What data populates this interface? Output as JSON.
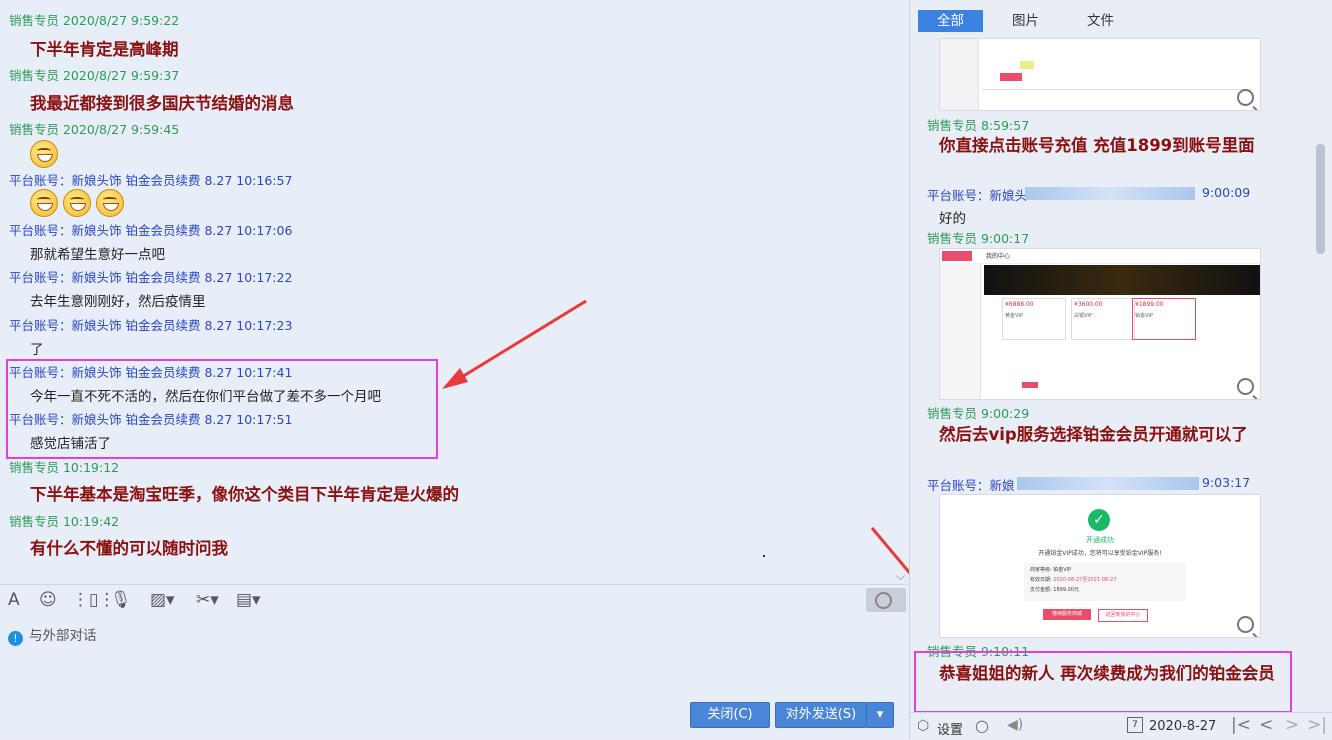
{
  "chat": {
    "messages": [
      {
        "sender": "销售专员 2020/8/27 9:59:22",
        "text": "下半年肯定是高峰期"
      },
      {
        "sender": "销售专员 2020/8/27 9:59:37",
        "text": "我最近都接到很多国庆节结婚的消息"
      },
      {
        "sender": "销售专员 2020/8/27 9:59:45",
        "emoji": "grin-emoji"
      },
      {
        "sender": "平台账号：新娘头饰 铂金会员续费 8.27   10:16:57",
        "emoji": "grin-emoji x3"
      },
      {
        "sender": "平台账号：新娘头饰 铂金会员续费 8.27   10:17:06",
        "text": "那就希望生意好一点吧"
      },
      {
        "sender": "平台账号：新娘头饰 铂金会员续费 8.27   10:17:22",
        "text": "去年生意刚刚好，然后疫情里"
      },
      {
        "sender": "平台账号：新娘头饰 铂金会员续费 8.27   10:17:23",
        "text": "了"
      },
      {
        "sender": "平台账号：新娘头饰 铂金会员续费 8.27   10:17:41",
        "text": "今年一直不死不活的，然后在你们平台做了差不多一个月吧"
      },
      {
        "sender": "平台账号：新娘头饰 铂金会员续费 8.27   10:17:51",
        "text": "感觉店铺活了"
      },
      {
        "sender": "销售专员  10:19:12",
        "text": "下半年基本是淘宝旺季，像你这个类目下半年肯定是火爆的"
      },
      {
        "sender": "销售专员  10:19:42",
        "text": "有什么不懂的可以随时问我"
      }
    ]
  },
  "composer": {
    "tip": "与外部对话",
    "close_label": "关闭(C)",
    "send_label": "对外发送(S)"
  },
  "history": {
    "tabs": [
      "全部",
      "图片",
      "文件"
    ],
    "items": [
      {
        "sender": "销售专员 8:59:57",
        "text": "你直接点击账号充值 充值1899到账号里面"
      },
      {
        "sender_a": "平台账号：新娘头",
        "sender_b": "9:00:09",
        "text": "好的"
      },
      {
        "sender": "销售专员 9:00:17"
      },
      {
        "sender": "销售专员 9:00:29",
        "text": "然后去vip服务选择铂金会员开通就可以了"
      },
      {
        "sender_a": "平台账号：新娘",
        "sender_b": "9:03:17"
      },
      {
        "sender": "销售专员 9:10:11",
        "text": "恭喜姐姐的新人 再次续费成为我们的铂金会员"
      }
    ],
    "thumb2": {
      "header": "我的中心",
      "prices": [
        "¥6888.00",
        "¥3600.00",
        "¥1899.00"
      ],
      "labels": [
        "黄金VIP",
        "白银VIP",
        "铂金VIP"
      ]
    },
    "thumb3": {
      "title": "开通成功",
      "subtitle": "开通铂金VIP成功，您将可以享受铂金VIP服务!",
      "rows": [
        [
          "商家等级:",
          "铂金VIP"
        ],
        [
          "有效日期:",
          "2020-08-27至2021-08-27"
        ],
        [
          "支付金额:",
          "1899.00元"
        ]
      ],
      "btn1": "继续服务商城",
      "btn2": "返回到我的中心"
    }
  },
  "footer": {
    "settings_label": "设置",
    "date": "2020-8-27"
  },
  "colors": {
    "accent": "#3b82e0",
    "highlight": "#e040e0",
    "arrow": "#e83a3a",
    "sales": "#2e9a57",
    "platform": "#2a46c9"
  }
}
